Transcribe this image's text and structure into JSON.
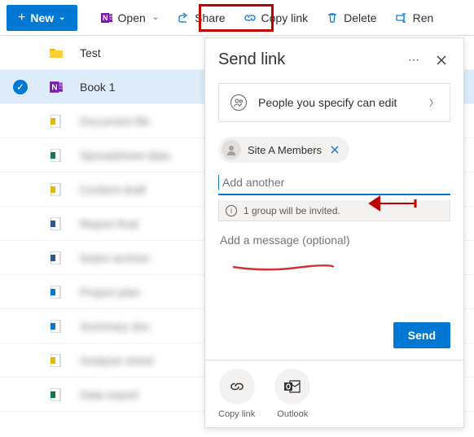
{
  "toolbar": {
    "new_label": "New",
    "open_label": "Open",
    "share_label": "Share",
    "copylink_label": "Copy link",
    "delete_label": "Delete",
    "rename_label": "Ren"
  },
  "files": {
    "items": [
      {
        "name": "Test",
        "selected": false,
        "icon": "folder",
        "blurred": false
      },
      {
        "name": "Book 1",
        "selected": true,
        "icon": "onenote",
        "blurred": false
      },
      {
        "name": "Document file",
        "selected": false,
        "icon": "word-yellow",
        "blurred": true
      },
      {
        "name": "Spreadsheet data",
        "selected": false,
        "icon": "excel",
        "blurred": true
      },
      {
        "name": "Content draft",
        "selected": false,
        "icon": "word-yellow",
        "blurred": true
      },
      {
        "name": "Report final",
        "selected": false,
        "icon": "word",
        "blurred": true
      },
      {
        "name": "Notes archive",
        "selected": false,
        "icon": "word",
        "blurred": true
      },
      {
        "name": "Project plan",
        "selected": false,
        "icon": "excel-blue",
        "blurred": true
      },
      {
        "name": "Summary doc",
        "selected": false,
        "icon": "excel-blue",
        "blurred": true
      },
      {
        "name": "Analysis sheet",
        "selected": false,
        "icon": "word-yellow",
        "blurred": true
      },
      {
        "name": "Data export",
        "selected": false,
        "icon": "excel",
        "blurred": true
      }
    ]
  },
  "share_panel": {
    "title": "Send link",
    "permission_text": "People you specify can edit",
    "chip_label": "Site A Members",
    "add_placeholder": "Add another",
    "info_text": "1 group will be invited.",
    "message_placeholder": "Add a message (optional)",
    "send_label": "Send",
    "actions": {
      "copylink_label": "Copy link",
      "outlook_label": "Outlook"
    }
  }
}
